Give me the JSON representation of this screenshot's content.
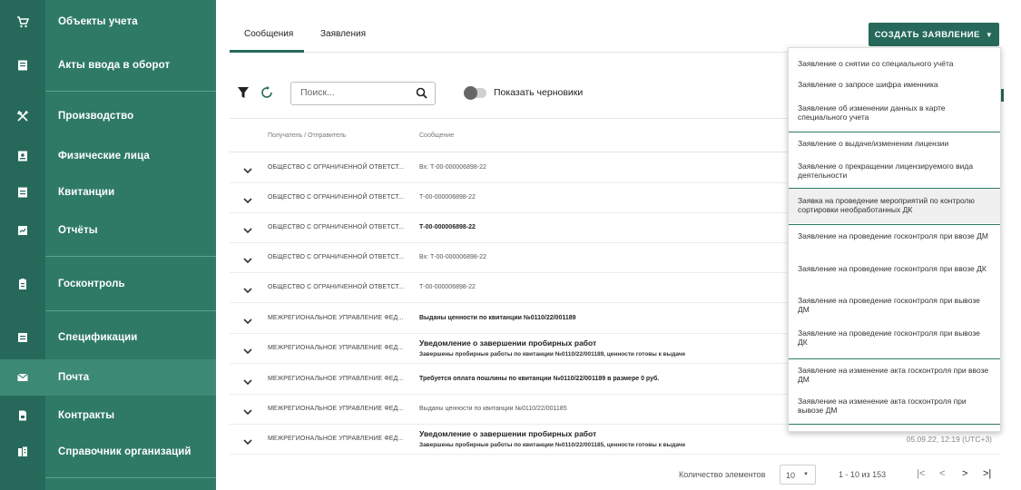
{
  "sidebar": {
    "items": [
      {
        "label": "Объекты учета",
        "icon": "cart-icon"
      },
      {
        "label": "Акты ввода в оборот",
        "icon": "document-icon"
      },
      {
        "label": "Производство",
        "icon": "tools-icon"
      },
      {
        "label": "Физические лица",
        "icon": "id-card-icon"
      },
      {
        "label": "Квитанции",
        "icon": "receipt-icon"
      },
      {
        "label": "Отчёты",
        "icon": "report-icon"
      },
      {
        "label": "Госконтроль",
        "icon": "clipboard-icon"
      },
      {
        "label": "Спецификации",
        "icon": "list-icon"
      },
      {
        "label": "Почта",
        "icon": "mail-icon"
      },
      {
        "label": "Контракты",
        "icon": "contract-icon"
      },
      {
        "label": "Справочник организаций",
        "icon": "building-icon"
      }
    ],
    "active_index": 8,
    "colors": {
      "bg": "#2e7a66",
      "icon_col": "#26695a",
      "active": "#3c8a75"
    }
  },
  "tabs": [
    {
      "label": "Сообщения",
      "active": true
    },
    {
      "label": "Заявления",
      "active": false
    }
  ],
  "create_button": {
    "label": "СОЗДАТЬ ЗАЯВЛЕНИЕ",
    "caret": "▼"
  },
  "toolbar": {
    "search_placeholder": "Поиск...",
    "toggle_label": "Показать черновики",
    "toggle_on": false
  },
  "table": {
    "headers": {
      "sender": "Получатель / Отправитель",
      "message": "Сообщение"
    },
    "rows": [
      {
        "sender": "ОБЩЕСТВО С ОГРАНИЧЕННОЙ ОТВЕТСТ...",
        "message": "Вх: Т-00-000006898-22",
        "style": "plain",
        "date": ""
      },
      {
        "sender": "ОБЩЕСТВО С ОГРАНИЧЕННОЙ ОТВЕТСТ...",
        "message": "Т-00-000006898-22",
        "style": "plain",
        "date": ""
      },
      {
        "sender": "ОБЩЕСТВО С ОГРАНИЧЕННОЙ ОТВЕТСТ...",
        "message": "Т-00-000006898-22",
        "style": "bold",
        "date": ""
      },
      {
        "sender": "ОБЩЕСТВО С ОГРАНИЧЕННОЙ ОТВЕТСТ...",
        "message": "Вх: Т-00-000006898-22",
        "style": "plain",
        "date": ""
      },
      {
        "sender": "ОБЩЕСТВО С ОГРАНИЧЕННОЙ ОТВЕТСТ...",
        "message": "Т-00-000006898-22",
        "style": "plain",
        "date": ""
      },
      {
        "sender": "МЕЖРЕГИОНАЛЬНОЕ УПРАВЛЕНИЕ ФЕД...",
        "message": "Выданы ценности по квитанции №0110/22/001189",
        "style": "bold",
        "date": ""
      },
      {
        "sender": "МЕЖРЕГИОНАЛЬНОЕ УПРАВЛЕНИЕ ФЕД...",
        "title": "Уведомление о завершении пробирных работ",
        "subtitle": "Завершены пробирные работы по квитанции №0110/22/001189, ценности готовы к выдаче",
        "style": "two-line",
        "date": ""
      },
      {
        "sender": "МЕЖРЕГИОНАЛЬНОЕ УПРАВЛЕНИЕ ФЕД...",
        "message": "Требуется оплата пошлины по квитанции №0110/22/001189 в размере 0 руб.",
        "style": "bold",
        "date": ""
      },
      {
        "sender": "МЕЖРЕГИОНАЛЬНОЕ УПРАВЛЕНИЕ ФЕД...",
        "message": "Выданы ценности по квитанции №0110/22/001185",
        "style": "plain",
        "date": ""
      },
      {
        "sender": "МЕЖРЕГИОНАЛЬНОЕ УПРАВЛЕНИЕ ФЕД...",
        "title": "Уведомление о завершении пробирных работ",
        "subtitle": "Завершены пробирные работы по квитанции №0110/22/001185, ценности готовы к выдаче",
        "style": "two-line",
        "date": "05.09.22, 12:19 (UTC+3)"
      }
    ]
  },
  "pagination": {
    "count_label": "Количество элементов",
    "page_size": "10",
    "range": "1 - 10 из 153",
    "first": "|<",
    "prev": "<",
    "next": ">",
    "last": ">|"
  },
  "dropdown": {
    "items": [
      "Заявление о снятии со специального учёта",
      "Заявление о запросе шифра именника",
      "Заявление об изменении данных в карте специального учета",
      "Заявление о выдаче/изменении лицензии",
      "Заявление о прекращении лицензируемого вида деятельности",
      "Заявка на проведение мероприятий по контролю сортировки необработанных ДК",
      "Заявление на проведение госконтроля при ввозе ДМ",
      "Заявление на проведение госконтроля при ввозе ДК",
      "Заявление на проведение госконтроля при вывозе ДМ",
      "Заявление на проведение госконтроля при вывозе ДК",
      "Заявление на изменение акта госконтроля при ввозе ДМ",
      "Заявление на изменение акта госконтроля при вывозе ДМ"
    ],
    "hover_index": 5
  }
}
